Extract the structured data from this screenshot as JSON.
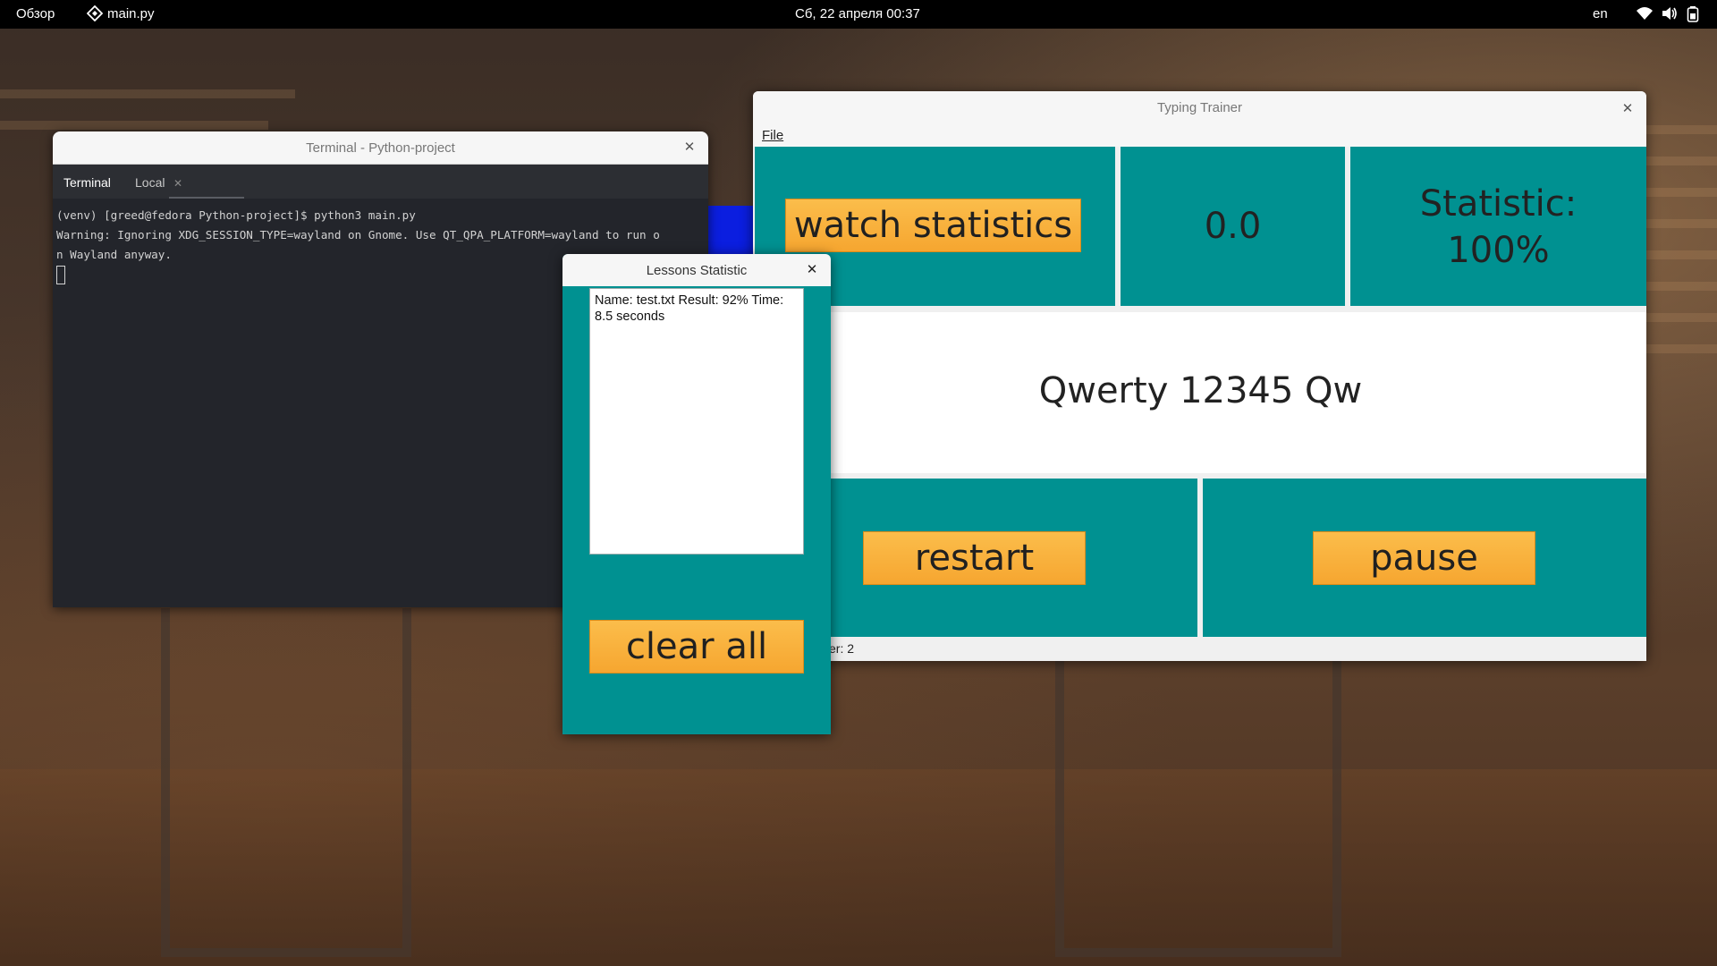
{
  "topbar": {
    "activities": "Обзор",
    "app_name": "main.py",
    "datetime": "Сб, 22 апреля  00:37",
    "keyboard_layout": "en",
    "icons": [
      "app-icon",
      "wifi-icon",
      "volume-icon",
      "battery-icon"
    ]
  },
  "terminal": {
    "title": "Terminal - Python-project",
    "tabs": [
      "Terminal",
      "Local"
    ],
    "lines": [
      "(venv) [greed@fedora Python-project]$ python3 main.py",
      "Warning: Ignoring XDG_SESSION_TYPE=wayland on Gnome. Use QT_QPA_PLATFORM=wayland to run o",
      "n Wayland anyway."
    ]
  },
  "trainer": {
    "title": "Typing Trainer",
    "menu_file": "File",
    "watch_statistics": "watch statistics",
    "speed_value": "0.0",
    "statistic_line1": "Statistic:",
    "statistic_line2": "100%",
    "lesson_text": "Qwerty 12345 Qw",
    "restart": "restart",
    "pause": "pause",
    "status": "er: 2"
  },
  "lessons": {
    "title": "Lessons Statistic",
    "items": [
      "Name: test.txt Result: 92% Time: 8.5 seconds"
    ],
    "clear_all": "clear all"
  },
  "colors": {
    "teal": "#009191",
    "orange": "#f6a630"
  }
}
